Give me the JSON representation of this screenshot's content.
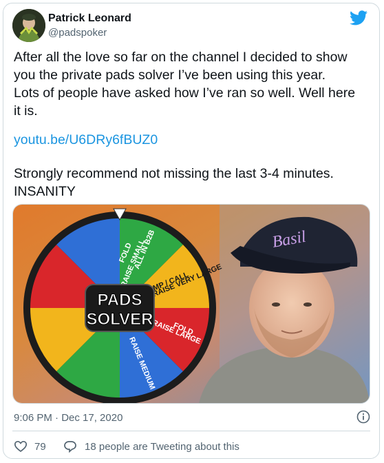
{
  "author": {
    "name": "Patrick Leonard",
    "handle": "@padspoker"
  },
  "tweet": {
    "text": "After all the love so far on the channel I decided to show\nyou the private pads solver I’ve been using this year.\nLots of people have asked how I’ve ran so well. Well here\nit is.",
    "link": "youtu.be/U6DRy6fBUZ0",
    "text2": "Strongly recommend not missing the last 3-4 minutes.\nINSANITY"
  },
  "media": {
    "wheel_segments": [
      {
        "label": "ALL IN B2B",
        "color": "#2f6fd6"
      },
      {
        "label": "FOLD",
        "color": "#2ea844"
      },
      {
        "label": "RAISE VERY LARGE",
        "color": "#f2b51c"
      },
      {
        "label": "RAISE LARGE",
        "color": "#d9262b"
      },
      {
        "label": "RAISE MEDIUM",
        "color": "#2f6fd6"
      },
      {
        "label": "RAISE SMALL",
        "color": "#2ea844"
      },
      {
        "label": "LIMP / CALL",
        "color": "#f2b51c"
      },
      {
        "label": "FOLD",
        "color": "#d9262b"
      }
    ],
    "badge_line1": "PADS",
    "badge_line2": "SOLVER",
    "cap_text": "Basil"
  },
  "footer": {
    "timestamp": "9:06 PM · Dec 17, 2020",
    "like_count": "79",
    "reply_text": "18 people are Tweeting about this"
  },
  "colors": {
    "link": "#1b95e0",
    "twitter_blue": "#1da1f2",
    "secondary_text": "#536471"
  }
}
